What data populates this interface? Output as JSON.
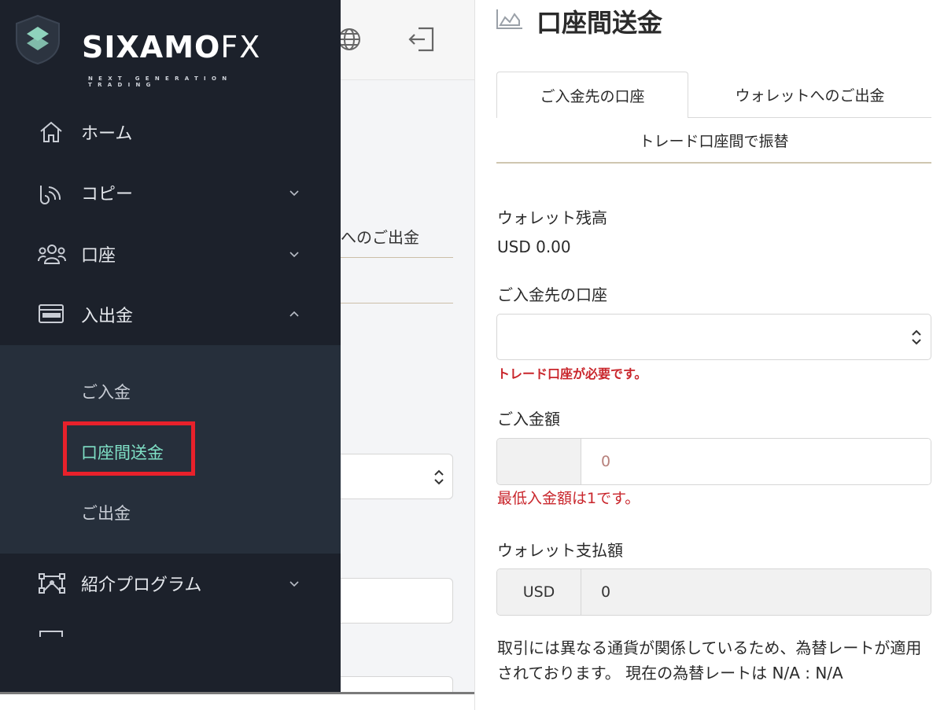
{
  "left_panel": {
    "background_page": {
      "tab_text": "へのご出金"
    },
    "logo": {
      "brand": "SIXAMO",
      "brand_suffix": "FX",
      "tagline": "NEXT GENERATION TRADING"
    },
    "nav": [
      {
        "label": "ホーム",
        "icon": "home-icon",
        "expanded": null
      },
      {
        "label": "コピー",
        "icon": "copy-signal-icon",
        "expanded": false
      },
      {
        "label": "口座",
        "icon": "users-icon",
        "expanded": false
      },
      {
        "label": "入出金",
        "icon": "card-icon",
        "expanded": true
      },
      {
        "label": "紹介プログラム",
        "icon": "network-icon",
        "expanded": false
      }
    ],
    "submenu": [
      {
        "label": "ご入金",
        "active": false
      },
      {
        "label": "口座間送金",
        "active": true
      },
      {
        "label": "ご出金",
        "active": false
      }
    ],
    "colors": {
      "sidebar": "#1c212b",
      "submenu": "#262f3b",
      "active": "#7fe0c6",
      "highlight": "#e8212b"
    }
  },
  "right_panel": {
    "page_title": "口座間送金",
    "tabs": [
      {
        "label": "ご入金先の口座",
        "selected": true
      },
      {
        "label": "ウォレットへのご出金",
        "selected": false
      },
      {
        "label": "トレード口座間で振替",
        "selected": false
      }
    ],
    "wallet_balance": {
      "label": "ウォレット残高",
      "value": "USD 0.00"
    },
    "deposit_account": {
      "label": "ご入金先の口座",
      "value": "",
      "error": "トレード口座が必要です。"
    },
    "deposit_amount": {
      "label": "ご入金額",
      "placeholder": "0",
      "error": "最低入金額は1です。"
    },
    "wallet_payment": {
      "label": "ウォレット支払額",
      "currency": "USD",
      "value": "0"
    },
    "rate_note": "取引には異なる通貨が関係しているため、為替レートが適用されております。 現在の為替レートは N/A : N/A",
    "colors": {
      "error": "#c9262c"
    }
  }
}
